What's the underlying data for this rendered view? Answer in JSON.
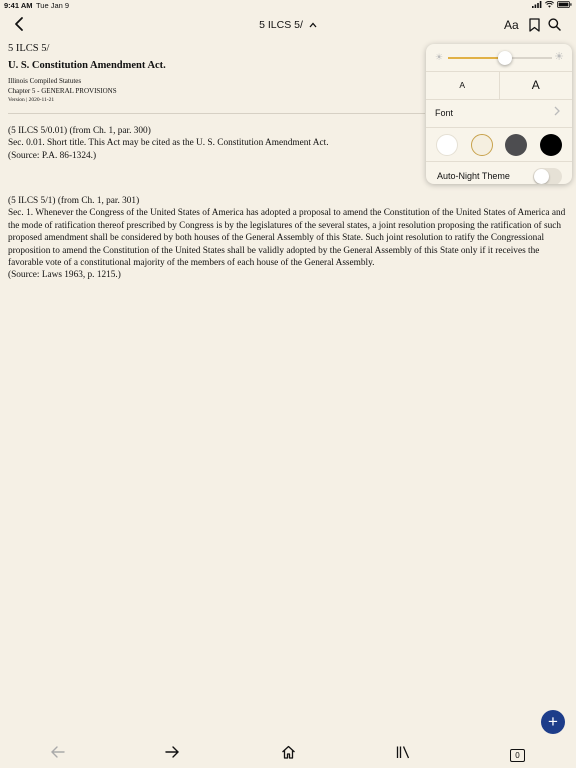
{
  "status": {
    "time": "9:41 AM",
    "date": "Tue Jan 9"
  },
  "nav": {
    "title": "5 ILCS 5/",
    "aa_label": "Aa"
  },
  "document": {
    "id": "5 ILCS 5/",
    "title": "U. S. Constitution Amendment Act.",
    "source": "Illinois Compiled Statutes",
    "chapter": "Chapter 5 - GENERAL PROVISIONS",
    "version": "Version | 2020-11-21"
  },
  "sections": [
    {
      "heading": "(5 ILCS 5/0.01) (from Ch. 1, par. 300)",
      "body": "Sec. 0.01. Short title. This Act may be cited as the U. S. Constitution Amendment Act.",
      "source": "(Source: P.A. 86-1324.)"
    },
    {
      "heading": "(5 ILCS 5/1) (from Ch. 1, par. 301)",
      "body": "Sec. 1. Whenever the Congress of the United States of America has adopted a proposal to amend the Constitution of the United States of America and the mode of ratification thereof prescribed by Congress is by the legislatures of the several states, a joint resolution proposing the ratification of such proposed amendment shall be considered by both houses of the General Assembly of this State. Such joint resolution to ratify the Congressional proposition to amend the Constitution of the United States shall be validly adopted by the General Assembly of this State only if it receives the favorable vote of a constitutional majority of the members of each house of the General Assembly.",
      "source": "(Source: Laws 1963, p. 1215.)"
    }
  ],
  "reader_settings": {
    "brightness": 0.55,
    "font_smaller_label": "A",
    "font_larger_label": "A",
    "font_label": "Font",
    "themes": [
      {
        "name": "white",
        "color": "#ffffff"
      },
      {
        "name": "sepia",
        "color": "#f5efe0"
      },
      {
        "name": "gray",
        "color": "#4d4d50"
      },
      {
        "name": "black",
        "color": "#000000"
      }
    ],
    "selected_theme": "sepia",
    "auto_night_label": "Auto-Night Theme",
    "auto_night_on": false
  },
  "bottom_bar": {
    "tabs_count": "0"
  },
  "colors": {
    "background": "#f5f0e5",
    "accent": "#1d3d8a",
    "slider": "#e1b146",
    "selected_ring": "#c8a24c"
  }
}
